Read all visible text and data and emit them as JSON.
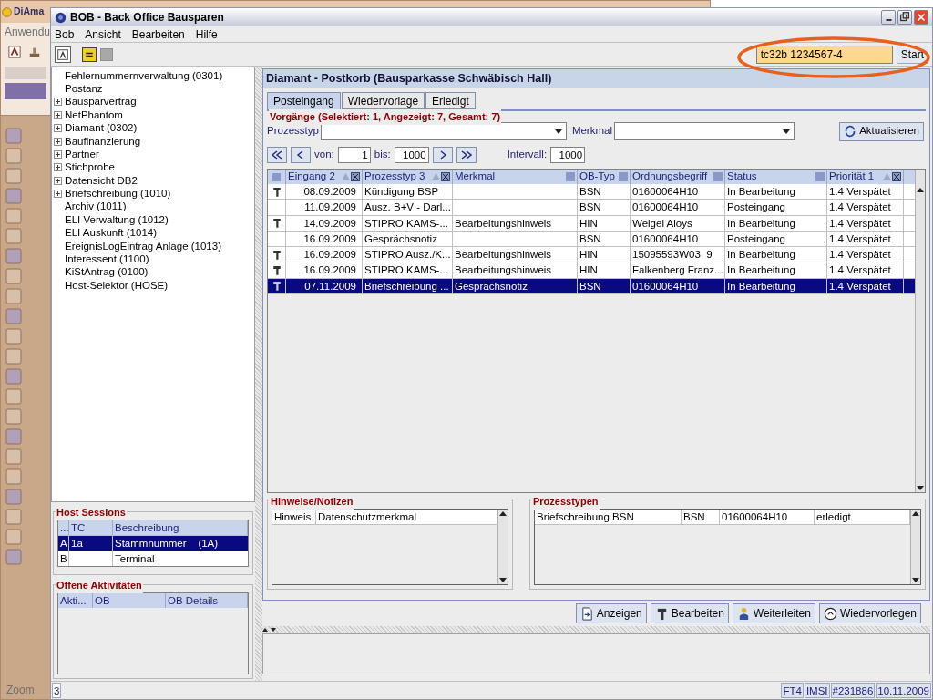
{
  "background_window": {
    "title": "DiAma",
    "menu": "Anwendu",
    "zoom_label": "Zoom"
  },
  "window": {
    "title": "BOB - Back Office Bausparen"
  },
  "menu": [
    "Bob",
    "Ansicht",
    "Bearbeiten",
    "Hilfe"
  ],
  "search": {
    "value": "tc32b 1234567-4",
    "button": "Start"
  },
  "tree": [
    {
      "label": "Fehlernummernverwaltung (0301)",
      "kind": "leaf"
    },
    {
      "label": "Postanz",
      "kind": "leaf"
    },
    {
      "label": "Bausparvertrag",
      "kind": "folder"
    },
    {
      "label": "NetPhantom",
      "kind": "folder"
    },
    {
      "label": "Diamant (0302)",
      "kind": "folder"
    },
    {
      "label": "Baufinanzierung",
      "kind": "folder"
    },
    {
      "label": "Partner",
      "kind": "folder"
    },
    {
      "label": "Stichprobe",
      "kind": "folder"
    },
    {
      "label": "Datensicht DB2",
      "kind": "folder"
    },
    {
      "label": "Briefschreibung (1010)",
      "kind": "folder"
    },
    {
      "label": "Archiv (1011)",
      "kind": "leaf"
    },
    {
      "label": "ELI Verwaltung (1012)",
      "kind": "leaf"
    },
    {
      "label": "ELI Auskunft (1014)",
      "kind": "leaf"
    },
    {
      "label": "EreignisLogEintrag Anlage (1013)",
      "kind": "leaf"
    },
    {
      "label": "Interessent (1100)",
      "kind": "leaf"
    },
    {
      "label": "KiStAntrag (0100)",
      "kind": "leaf"
    },
    {
      "label": "Host-Selektor (HOSE)",
      "kind": "leaf"
    }
  ],
  "host_sessions": {
    "title": "Host Sessions",
    "columns": [
      "...",
      "TC",
      "Beschreibung"
    ],
    "rows": [
      {
        "id": "A",
        "tc": "1a",
        "description": "Stammnummer    (1A)",
        "selected": true
      },
      {
        "id": "B",
        "description": "Terminal",
        "selected": false
      }
    ]
  },
  "open_activities": {
    "title": "Offene Aktivitäten",
    "columns": [
      "Akti...",
      "OB",
      "OB Details"
    ]
  },
  "panel": {
    "title": "Diamant - Postkorb (Bausparkasse Schwäbisch Hall)"
  },
  "tabs": [
    {
      "label": "Posteingang",
      "selected": true
    },
    {
      "label": "Wiedervorlage",
      "selected": false
    },
    {
      "label": "Erledigt",
      "selected": false
    }
  ],
  "group_title": "Vorgänge (Selektiert: 1, Angezeigt: 7, Gesamt: 7)",
  "filters": {
    "process_type_label": "Prozesstyp",
    "feature_label": "Merkmal",
    "refresh": "Aktualisieren"
  },
  "paging": {
    "from_label": "von:",
    "from": "1",
    "to_label": "bis:",
    "to": "1000",
    "interval_label": "Intervall:",
    "interval": "1000"
  },
  "table": {
    "columns": [
      {
        "label": "Eingang",
        "sort": "2"
      },
      {
        "label": "Prozesstyp",
        "sort": "3"
      },
      {
        "label": "Merkmal"
      },
      {
        "label": "OB-Typ"
      },
      {
        "label": "Ordnungsbegriff"
      },
      {
        "label": "Status"
      },
      {
        "label": "Priorität",
        "sort": "1"
      }
    ],
    "rows": [
      {
        "kind": "tool",
        "selected": false,
        "cells": [
          "08.09.2009",
          "Kündigung BSP",
          "",
          "BSN",
          "01600064H10",
          "In Bearbeitung",
          "1.4 Verspätet"
        ]
      },
      {
        "kind": "plain",
        "selected": false,
        "cells": [
          "11.09.2009",
          "Ausz. B+V - Darl...",
          "",
          "BSN",
          "01600064H10",
          "Posteingang",
          "1.4 Verspätet"
        ]
      },
      {
        "kind": "tool",
        "selected": false,
        "cells": [
          "14.09.2009",
          "STIPRO KAMS-...",
          "Bearbeitungshinweis",
          "HIN",
          "Weigel Aloys",
          "In Bearbeitung",
          "1.4 Verspätet"
        ]
      },
      {
        "kind": "plain",
        "selected": false,
        "cells": [
          "16.09.2009",
          "Gesprächsnotiz",
          "",
          "BSN",
          "01600064H10",
          "Posteingang",
          "1.4 Verspätet"
        ]
      },
      {
        "kind": "tool",
        "selected": false,
        "cells": [
          "16.09.2009",
          "STIPRO Ausz./K...",
          "Bearbeitungshinweis",
          "HIN",
          "15095593W03  9",
          "In Bearbeitung",
          "1.4 Verspätet"
        ]
      },
      {
        "kind": "tool",
        "selected": false,
        "cells": [
          "16.09.2009",
          "STIPRO KAMS-...",
          "Bearbeitungshinweis",
          "HIN",
          "Falkenberg Franz...",
          "In Bearbeitung",
          "1.4 Verspätet"
        ]
      },
      {
        "kind": "tool",
        "selected": true,
        "cells": [
          "07.11.2009",
          "Briefschreibung ...",
          "Gesprächsnotiz",
          "BSN",
          "01600064H10",
          "In Bearbeitung",
          "1.4 Verspätet"
        ]
      }
    ]
  },
  "notes": {
    "title": "Hinweise/Notizen",
    "rows": [
      [
        "Hinweis",
        "Datenschutzmerkmal"
      ]
    ]
  },
  "process_types": {
    "title": "Prozesstypen",
    "rows": [
      [
        "Briefschreibung BSN",
        "BSN",
        "01600064H10",
        "erledigt"
      ]
    ]
  },
  "actions": [
    {
      "label": "Anzeigen",
      "kind": "view"
    },
    {
      "label": "Bearbeiten",
      "kind": "edit"
    },
    {
      "label": "Weiterleiten",
      "kind": "forward"
    },
    {
      "label": "Wiedervorlegen",
      "kind": "resubmit"
    }
  ],
  "status_bar": {
    "page": "3",
    "items": [
      "FT4",
      "IMSI",
      "#231886",
      "10.11.2009"
    ]
  }
}
